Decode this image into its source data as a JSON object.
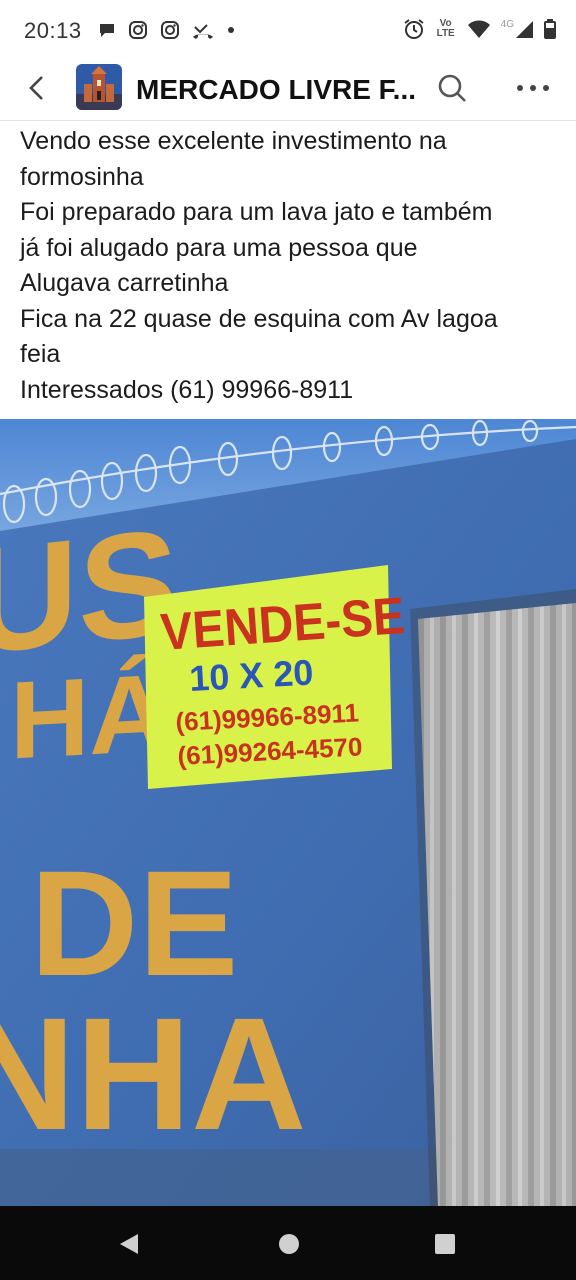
{
  "status_bar": {
    "time": "20:13",
    "left_icons": [
      "chat-bubble-icon",
      "instagram-icon",
      "instagram-icon",
      "missed-call-icon",
      "dot-icon"
    ],
    "right_icons": [
      "alarm-icon",
      "volte-icon",
      "wifi-icon",
      "signal-4g-icon",
      "battery-icon"
    ],
    "volte_label": "Vo LTE",
    "network_label": "4G"
  },
  "app_bar": {
    "title": "MERCADO LIVRE F...",
    "icons": [
      "back-arrow-icon",
      "search-icon",
      "more-icon"
    ]
  },
  "post": {
    "lines": [
      "Vendo esse excelente investimento na",
      "formosinha",
      "Foi preparado para um lava jato e também",
      "já foi alugado para uma pessoa que",
      "Alugava carretinha",
      "Fica na 22 quase de esquina com Av lagoa",
      "feia",
      "Interessados (61) 99966-8911"
    ]
  },
  "photo": {
    "sign": {
      "headline": "VENDE-SE",
      "size": "10 X 20",
      "phone1": "(61)99966-8911",
      "phone2": "(61)99264-4570"
    },
    "wall_text": {
      "line1": "US",
      "line2": "HÁ",
      "line3": "DE",
      "line4": "NHA"
    },
    "colors": {
      "sky": "#5a8fd6",
      "wall": "#4a78bd",
      "wall_letters": "#d9a545",
      "sign": "#d8f24a",
      "sign_red": "#c8321f",
      "sign_blue": "#2a56b8"
    }
  },
  "nav_bar": {
    "icons": [
      "back-triangle-icon",
      "home-circle-icon",
      "recents-square-icon"
    ]
  }
}
